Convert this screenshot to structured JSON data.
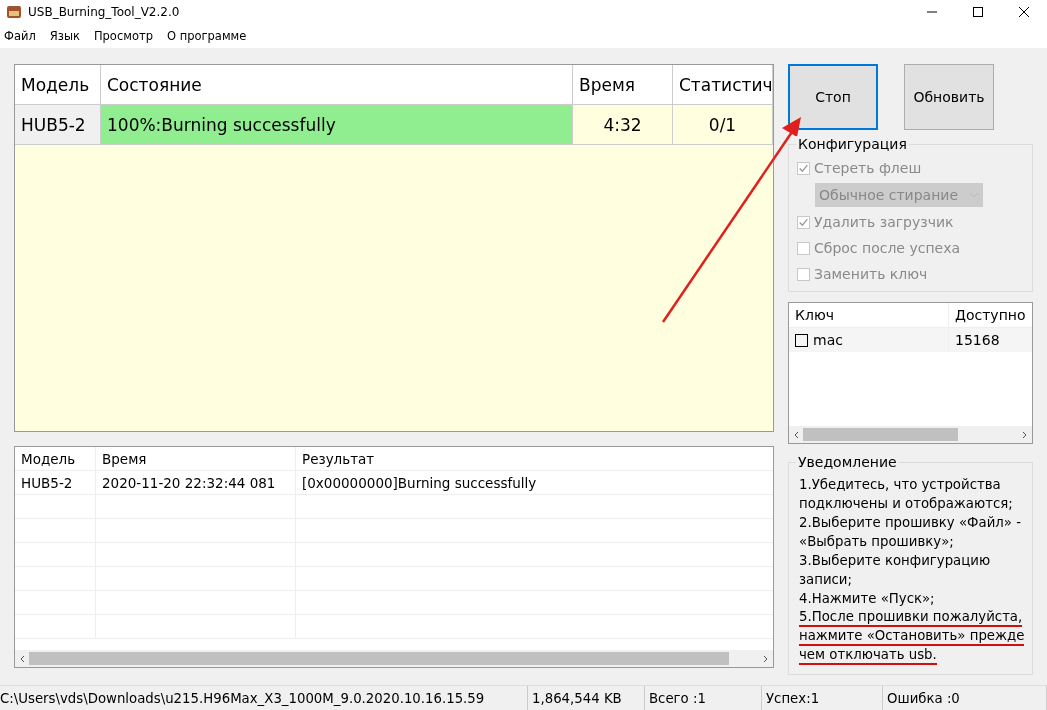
{
  "window": {
    "title": "USB_Burning_Tool_V2.2.0"
  },
  "menu": [
    "Файл",
    "Язык",
    "Просмотр",
    "О программе"
  ],
  "devices": {
    "columns": [
      "Модель",
      "Состояние",
      "Время",
      "Статистич"
    ],
    "rows": [
      {
        "model": "HUB5-2",
        "status": "100%:Burning successfully",
        "color": "#90ee90",
        "time": "4:32",
        "stats": "0/1"
      }
    ]
  },
  "buttons": [
    {
      "label": "Стоп",
      "focused": true
    },
    {
      "label": "Обновить",
      "focused": false
    }
  ],
  "config": {
    "title": "Конфигурация",
    "options": [
      {
        "kind": "checkbox",
        "label": "Стереть флеш",
        "checked": true,
        "disabled": true
      },
      {
        "kind": "dropdown",
        "value": "Обычное стирание",
        "disabled": true
      },
      {
        "kind": "checkbox",
        "label": "Удалить загрузчик",
        "checked": true,
        "disabled": true
      },
      {
        "kind": "checkbox",
        "label": "Сброс после успеха",
        "checked": false,
        "disabled": true
      },
      {
        "kind": "checkbox",
        "label": "Заменить ключ",
        "checked": false,
        "disabled": true
      }
    ]
  },
  "keys": {
    "columns": [
      "Ключ",
      "Доступно"
    ],
    "rows": [
      {
        "name": "mac",
        "checked": false,
        "available": "15168"
      }
    ]
  },
  "log": {
    "columns": [
      "Модель",
      "Время",
      "Результат"
    ],
    "rows": [
      {
        "model": "HUB5-2",
        "time": "2020-11-20 22:32:44 081",
        "result": "[0x00000000]Burning successfully"
      }
    ]
  },
  "notice": {
    "title": "Уведомление",
    "lines": [
      {
        "text": "1.Убедитесь, что устройства",
        "underlined": false
      },
      {
        "text": "подключены и отображаются;",
        "underlined": false
      },
      {
        "text": "2.Выберите прошивку «Файл» -",
        "underlined": false
      },
      {
        "text": "«Выбрать прошивку»;",
        "underlined": false
      },
      {
        "text": "3.Выберите конфигурацию",
        "underlined": false
      },
      {
        "text": "записи;",
        "underlined": false
      },
      {
        "text": "4.Нажмите «Пуск»;",
        "underlined": false
      },
      {
        "text": "5.После прошивки пожалуйста,",
        "underlined": true
      },
      {
        "text": "нажмите «Остановить» прежде",
        "underlined": true
      },
      {
        "text": "чем отключать usb.",
        "underlined": true
      }
    ]
  },
  "status_bar": [
    "C:\\Users\\vds\\Downloads\\u215.H96Max_X3_1000M_9.0.2020.10.16.15.59",
    "1,864,544 KB",
    "Всего :1",
    "Успех:1",
    "Ошибка :0"
  ]
}
